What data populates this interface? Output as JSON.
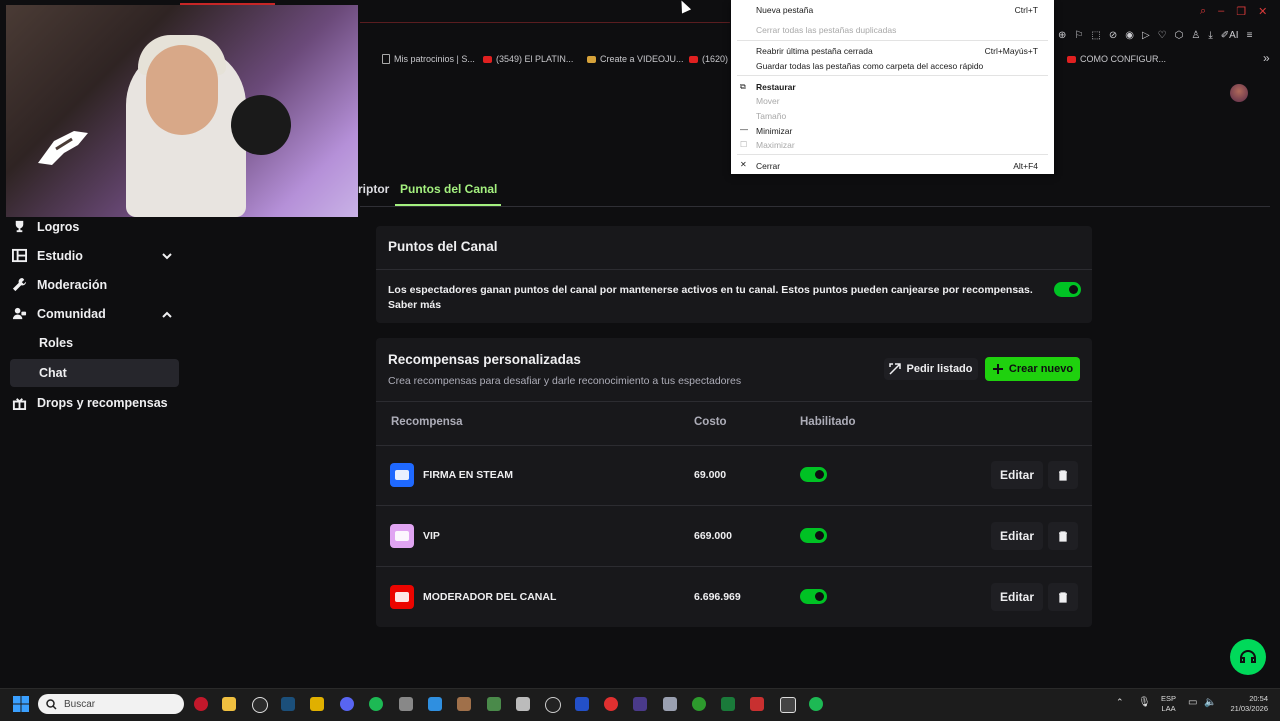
{
  "bookmarks": [
    {
      "label": "Mis patrocinios | S...",
      "icon": "page-icon"
    },
    {
      "label": "(3549) El PLATIN...",
      "icon": "youtube-icon"
    },
    {
      "label": "Create a VIDEOJU...",
      "icon": "game-icon"
    },
    {
      "label": "(1620)",
      "icon": "youtube-icon"
    },
    {
      "label": "COMO CONFIGUR...",
      "icon": "youtube-icon"
    }
  ],
  "sidebar": {
    "items": [
      {
        "label": "Logros",
        "icon": "trophy-icon"
      },
      {
        "label": "Estudio",
        "icon": "studio-icon"
      },
      {
        "label": "Moderación",
        "icon": "wrench-icon"
      },
      {
        "label": "Comunidad",
        "icon": "community-icon"
      },
      {
        "label": "Roles"
      },
      {
        "label": "Chat"
      },
      {
        "label": "Drops y recompensas",
        "icon": "gift-icon"
      }
    ]
  },
  "tabs": {
    "previous": "riptor",
    "active": "Puntos del Canal"
  },
  "channel_points": {
    "title": "Puntos del Canal",
    "description": "Los espectadores ganan puntos del canal por mantenerse activos en tu canal. Estos puntos pueden canjearse por recompensas. Saber más",
    "enabled": true
  },
  "rewards": {
    "title": "Recompensas personalizadas",
    "subtitle": "Crea recompensas para desafiar y darle reconocimiento a tus espectadores",
    "btn_list": "Pedir listado",
    "btn_create": "Crear nuevo",
    "columns": [
      "Recompensa",
      "Costo",
      "Habilitado"
    ],
    "rows": [
      {
        "name": "FIRMA EN STEAM",
        "cost": "69.000",
        "enabled": true,
        "color": "#1f69ff",
        "edit": "Editar"
      },
      {
        "name": "VIP",
        "cost": "669.000",
        "enabled": true,
        "color": "#e0a4f2",
        "edit": "Editar"
      },
      {
        "name": "MODERADOR DEL CANAL",
        "cost": "6.696.969",
        "enabled": true,
        "color": "#eb0400",
        "edit": "Editar"
      }
    ]
  },
  "context_menu": {
    "items": [
      {
        "label": "Nueva pestaña",
        "shortcut": "Ctrl+T",
        "disabled": false
      },
      {
        "label": "Cerrar todas las pestañas duplicadas",
        "shortcut": "",
        "disabled": true
      },
      {
        "label": "Reabrir última pestaña cerrada",
        "shortcut": "Ctrl+Mayús+T",
        "disabled": false
      },
      {
        "label": "Guardar todas las pestañas como carpeta del acceso rápido",
        "shortcut": "",
        "disabled": false
      },
      {
        "label": "Restaurar",
        "shortcut": "",
        "disabled": false
      },
      {
        "label": "Mover",
        "shortcut": "",
        "disabled": true
      },
      {
        "label": "Tamaño",
        "shortcut": "",
        "disabled": true
      },
      {
        "label": "Minimizar",
        "shortcut": "",
        "disabled": false
      },
      {
        "label": "Maximizar",
        "shortcut": "",
        "disabled": true
      },
      {
        "label": "Cerrar",
        "shortcut": "Alt+F4",
        "disabled": false
      }
    ]
  },
  "taskbar": {
    "search_placeholder": "Buscar",
    "lang_line1": "ESP",
    "lang_line2": "LAA",
    "time": "20:54",
    "date": "21/03/2026"
  },
  "colors": {
    "accent": "#a4f07f",
    "create_button": "#1fd10e",
    "toggle_on": "#00c224"
  }
}
